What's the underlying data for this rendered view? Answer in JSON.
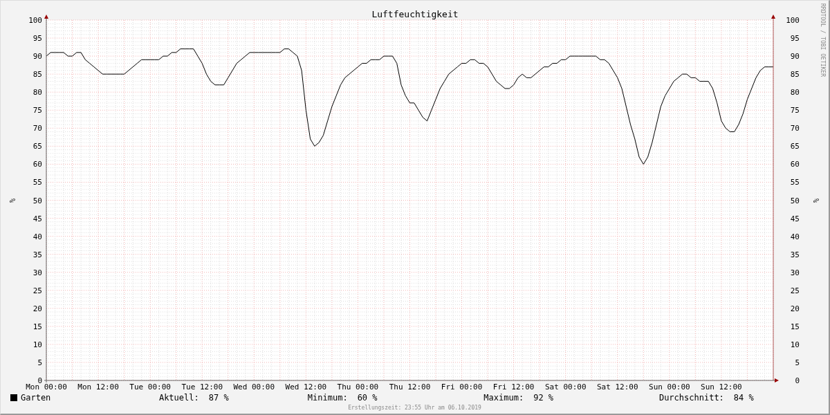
{
  "chart_data": {
    "type": "line",
    "title": "Luftfeuchtigkeit",
    "ylabel": "%",
    "grid": true,
    "ylim": [
      0,
      100
    ],
    "yticks": [
      0,
      5,
      10,
      15,
      20,
      25,
      30,
      35,
      40,
      45,
      50,
      55,
      60,
      65,
      70,
      75,
      80,
      85,
      90,
      95,
      100
    ],
    "categories": [
      "Mon 00:00",
      null,
      null,
      null,
      null,
      null,
      null,
      null,
      null,
      null,
      null,
      null,
      "Mon 12:00",
      null,
      null,
      null,
      null,
      null,
      null,
      null,
      null,
      null,
      null,
      null,
      "Tue 00:00",
      null,
      null,
      null,
      null,
      null,
      null,
      null,
      null,
      null,
      null,
      null,
      "Tue 12:00",
      null,
      null,
      null,
      null,
      null,
      null,
      null,
      null,
      null,
      null,
      null,
      "Wed 00:00",
      null,
      null,
      null,
      null,
      null,
      null,
      null,
      null,
      null,
      null,
      null,
      "Wed 12:00",
      null,
      null,
      null,
      null,
      null,
      null,
      null,
      null,
      null,
      null,
      null,
      "Thu 00:00",
      null,
      null,
      null,
      null,
      null,
      null,
      null,
      null,
      null,
      null,
      null,
      "Thu 12:00",
      null,
      null,
      null,
      null,
      null,
      null,
      null,
      null,
      null,
      null,
      null,
      "Fri 00:00",
      null,
      null,
      null,
      null,
      null,
      null,
      null,
      null,
      null,
      null,
      null,
      "Fri 12:00",
      null,
      null,
      null,
      null,
      null,
      null,
      null,
      null,
      null,
      null,
      null,
      "Sat 00:00",
      null,
      null,
      null,
      null,
      null,
      null,
      null,
      null,
      null,
      null,
      null,
      "Sat 12:00",
      null,
      null,
      null,
      null,
      null,
      null,
      null,
      null,
      null,
      null,
      null,
      "Sun 00:00",
      null,
      null,
      null,
      null,
      null,
      null,
      null,
      null,
      null,
      null,
      null,
      "Sun 12:00",
      null,
      null,
      null,
      null,
      null,
      null,
      null,
      null,
      null,
      null,
      null,
      null
    ],
    "series": [
      {
        "name": "Garten",
        "color": "#000000",
        "values": [
          90,
          91,
          91,
          91,
          91,
          90,
          90,
          91,
          91,
          89,
          88,
          87,
          86,
          85,
          85,
          85,
          85,
          85,
          85,
          86,
          87,
          88,
          89,
          89,
          89,
          89,
          89,
          90,
          90,
          91,
          91,
          92,
          92,
          92,
          92,
          90,
          88,
          85,
          83,
          82,
          82,
          82,
          84,
          86,
          88,
          89,
          90,
          91,
          91,
          91,
          91,
          91,
          91,
          91,
          91,
          92,
          92,
          91,
          90,
          86,
          75,
          67,
          65,
          66,
          68,
          72,
          76,
          79,
          82,
          84,
          85,
          86,
          87,
          88,
          88,
          89,
          89,
          89,
          90,
          90,
          90,
          88,
          82,
          79,
          77,
          77,
          75,
          73,
          72,
          75,
          78,
          81,
          83,
          85,
          86,
          87,
          88,
          88,
          89,
          89,
          88,
          88,
          87,
          85,
          83,
          82,
          81,
          81,
          82,
          84,
          85,
          84,
          84,
          85,
          86,
          87,
          87,
          88,
          88,
          89,
          89,
          90,
          90,
          90,
          90,
          90,
          90,
          90,
          89,
          89,
          88,
          86,
          84,
          81,
          76,
          71,
          67,
          62,
          60,
          62,
          66,
          71,
          76,
          79,
          81,
          83,
          84,
          85,
          85,
          84,
          84,
          83,
          83,
          83,
          81,
          77,
          72,
          70,
          69,
          69,
          71,
          74,
          78,
          81,
          84,
          86,
          87,
          87,
          87
        ]
      }
    ]
  },
  "y_axis_right": {
    "label": "%",
    "ticks": [
      "100",
      "95",
      "90",
      "85",
      "80",
      "75",
      "70",
      "65",
      "60",
      "55",
      "50",
      "45",
      "40",
      "35",
      "30",
      "25",
      "20",
      "15",
      "10",
      "5",
      "0"
    ]
  },
  "watermark_side": "RRDTOOL / TOBI OETIKER",
  "legend": {
    "stats": [
      {
        "label": "Aktuell:",
        "value": "87 %"
      },
      {
        "label": "Minimum:",
        "value": "60 %"
      },
      {
        "label": "Maximum:",
        "value": "92 %"
      },
      {
        "label": "Durchschnitt:",
        "value": "84 %"
      }
    ]
  },
  "footer": "Erstellungszeit: 23:55 Uhr am 06.10.2019"
}
